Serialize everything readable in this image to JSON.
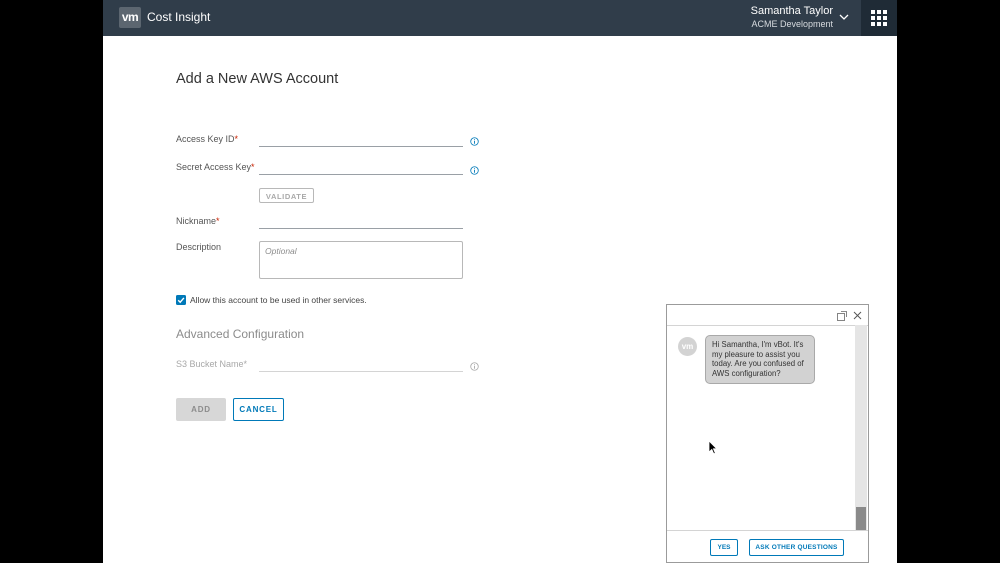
{
  "header": {
    "logo_text": "vm",
    "app_title": "Cost Insight",
    "user_name": "Samantha Taylor",
    "user_org": "ACME Development",
    "user_menu_icon": "chevron-down-icon",
    "apps_icon": "apps-grid-icon"
  },
  "form": {
    "title": "Add a New AWS Account",
    "access_key_label": "Access Key ID",
    "access_key_value": "",
    "secret_key_label": "Secret Access Key",
    "secret_key_value": "",
    "required_marker": "*",
    "validate_label": "VALIDATE",
    "nickname_label": "Nickname",
    "nickname_value": "",
    "description_label": "Description",
    "description_placeholder": "Optional",
    "share_checkbox_label": "Allow this account to be used in other services.",
    "share_checked": true,
    "advanced_title": "Advanced Configuration",
    "s3_bucket_label": "S3 Bucket Name*",
    "s3_bucket_value": "",
    "add_label": "ADD",
    "cancel_label": "CANCEL",
    "info_icon": "info-icon"
  },
  "chat": {
    "avatar_text": "vm",
    "message": "Hi Samantha, I'm vBot. It's my pleasure to assist you today. Are you confused of AWS configuration?",
    "yes_label": "YES",
    "ask_label": "ASK OTHER QUESTIONS",
    "popout_icon": "popout-icon",
    "close_icon": "close-icon"
  },
  "colors": {
    "header_bg": "#303d4a",
    "accent": "#0079b8",
    "required": "#c92100"
  }
}
